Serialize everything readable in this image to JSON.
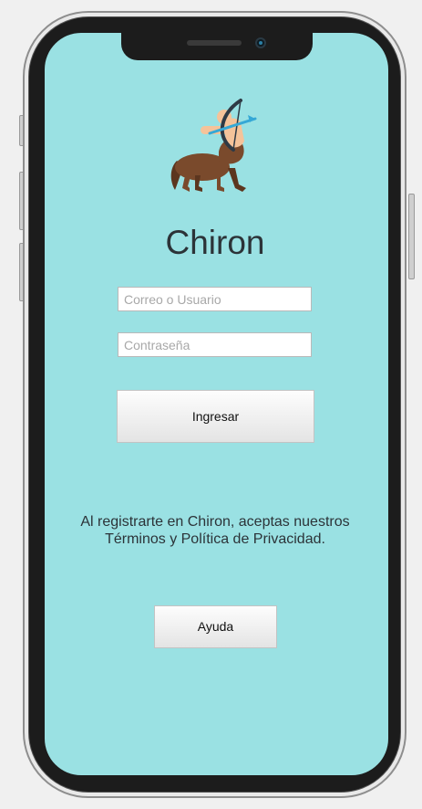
{
  "app": {
    "title": "Chiron",
    "logo_icon": "centaur-archer-icon"
  },
  "login_form": {
    "username_placeholder": "Correo o Usuario",
    "username_value": "",
    "password_placeholder": "Contraseña",
    "password_value": "",
    "submit_label": "Ingresar"
  },
  "terms": {
    "line1": "Al registrarte en Chiron, aceptas nuestros",
    "line2": "Términos y Política de Privacidad."
  },
  "help": {
    "label": "Ayuda"
  },
  "colors": {
    "screen_background": "#9ae1e3",
    "title_text": "#2c3338",
    "centaur_body": "#7a4a2c",
    "centaur_skin": "#f5c39a",
    "bow": "#2f3a45",
    "arrow": "#35a8d6"
  }
}
